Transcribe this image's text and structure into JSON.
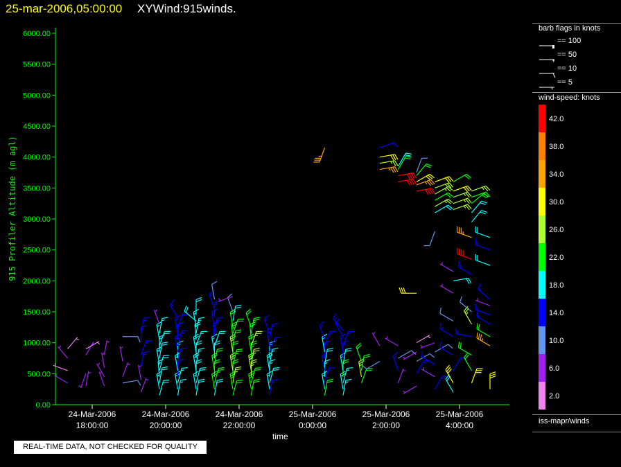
{
  "title": {
    "datetime": "25-mar-2006,05:00:00",
    "product": "XYWind:915winds."
  },
  "y_axis_label": "915 Profiler Altitude (m agl)",
  "x_axis_label": "time",
  "quality_notice": "REAL-TIME DATA, NOT CHECKED FOR QUALITY",
  "legend": {
    "barb_title": "barb flags in knots",
    "barb_keys": [
      {
        "label": "== 100",
        "value": 100
      },
      {
        "label": "== 50",
        "value": 50
      },
      {
        "label": "== 10",
        "value": 10
      },
      {
        "label": "== 5",
        "value": 5
      }
    ],
    "colorbar_title": "wind-speed: knots",
    "colorbar": [
      {
        "label": "42.0",
        "color": "#ff0000"
      },
      {
        "label": "38.0",
        "color": "#ff8000"
      },
      {
        "label": "34.0",
        "color": "#ffa500"
      },
      {
        "label": "30.0",
        "color": "#ffff00"
      },
      {
        "label": "26.0",
        "color": "#adff2f"
      },
      {
        "label": "22.0",
        "color": "#00ff00"
      },
      {
        "label": "18.0",
        "color": "#00ffff"
      },
      {
        "label": "14.0",
        "color": "#0000ff"
      },
      {
        "label": "10.0",
        "color": "#6495ed"
      },
      {
        "label": "6.0",
        "color": "#a020f0"
      },
      {
        "label": "2.0",
        "color": "#ee82ee"
      }
    ],
    "source": "iss-mapr/winds"
  },
  "chart_data": {
    "type": "wind-barb time-height",
    "title": "XYWind:915winds.",
    "xlabel": "time",
    "ylabel": "915 Profiler Altitude (m agl)",
    "xlim_hours": [
      17.0,
      29.35
    ],
    "ylim": [
      0,
      6200
    ],
    "y_ticks": [
      "0.00",
      "500.00",
      "1000.00",
      "1500.00",
      "2000.00",
      "2500.00",
      "3000.00",
      "3500.00",
      "4000.00",
      "4500.00",
      "5000.00",
      "5500.00",
      "6000.00"
    ],
    "x_ticks": [
      {
        "hour": 18,
        "date": "24-Mar-2006",
        "time": "18:00:00"
      },
      {
        "hour": 20,
        "date": "24-Mar-2006",
        "time": "20:00:00"
      },
      {
        "hour": 22,
        "date": "24-Mar-2006",
        "time": "22:00:00"
      },
      {
        "hour": 24,
        "date": "25-Mar-2006",
        "time": "0:00:00"
      },
      {
        "hour": 26,
        "date": "25-Mar-2006",
        "time": "2:00:00"
      },
      {
        "hour": 28,
        "date": "25-Mar-2006",
        "time": "4:00:00"
      }
    ],
    "speed_bins_knots": [
      0,
      4,
      8,
      12,
      16,
      20,
      24,
      28,
      32,
      36,
      40
    ],
    "profiles": [
      {
        "hour": 17.33,
        "obs": [
          [
            350,
            4,
            300
          ],
          [
            550,
            3,
            290
          ],
          [
            750,
            4,
            320
          ],
          [
            900,
            3,
            40
          ]
        ]
      },
      {
        "hour": 17.83,
        "obs": [
          [
            300,
            5,
            10
          ],
          [
            500,
            6,
            200
          ],
          [
            800,
            4,
            30
          ],
          [
            900,
            3,
            60
          ]
        ]
      },
      {
        "hour": 18.33,
        "obs": [
          [
            300,
            5,
            340
          ],
          [
            450,
            6,
            330
          ],
          [
            600,
            7,
            350
          ],
          [
            800,
            6,
            10
          ]
        ]
      },
      {
        "hour": 18.83,
        "obs": [
          [
            350,
            9,
            80
          ],
          [
            450,
            7,
            20
          ],
          [
            700,
            6,
            350
          ],
          [
            1100,
            10,
            90
          ]
        ]
      },
      {
        "hour": 19.33,
        "obs": [
          [
            200,
            7,
            20
          ],
          [
            400,
            7,
            350
          ],
          [
            600,
            14,
            10
          ],
          [
            800,
            13,
            20
          ],
          [
            1000,
            14,
            0
          ],
          [
            1150,
            14,
            10
          ]
        ]
      },
      {
        "hour": 19.83,
        "obs": [
          [
            150,
            18,
            15
          ],
          [
            250,
            17,
            350
          ],
          [
            350,
            18,
            10
          ],
          [
            450,
            17,
            355
          ],
          [
            550,
            18,
            15
          ],
          [
            650,
            17,
            350
          ],
          [
            750,
            18,
            10
          ],
          [
            850,
            17,
            0
          ],
          [
            950,
            18,
            20
          ],
          [
            1050,
            17,
            350
          ],
          [
            1150,
            16,
            10
          ],
          [
            1300,
            6,
            340
          ]
        ]
      },
      {
        "hour": 20.33,
        "obs": [
          [
            150,
            17,
            10
          ],
          [
            250,
            18,
            350
          ],
          [
            350,
            17,
            15
          ],
          [
            450,
            15,
            0
          ],
          [
            550,
            17,
            350
          ],
          [
            650,
            14,
            10
          ],
          [
            750,
            17,
            0
          ],
          [
            850,
            15,
            350
          ],
          [
            950,
            14,
            15
          ],
          [
            1050,
            15,
            0
          ],
          [
            1150,
            14,
            350
          ],
          [
            1250,
            14,
            20
          ],
          [
            1400,
            13,
            330
          ]
        ]
      },
      {
        "hour": 20.83,
        "obs": [
          [
            150,
            18,
            10
          ],
          [
            250,
            17,
            350
          ],
          [
            350,
            18,
            15
          ],
          [
            450,
            19,
            0
          ],
          [
            550,
            18,
            350
          ],
          [
            650,
            17,
            10
          ],
          [
            750,
            18,
            0
          ],
          [
            850,
            19,
            350
          ],
          [
            950,
            17,
            20
          ],
          [
            1050,
            18,
            355
          ],
          [
            1150,
            17,
            10
          ],
          [
            1250,
            16,
            350
          ],
          [
            1350,
            18,
            310
          ],
          [
            1450,
            18,
            0
          ]
        ]
      },
      {
        "hour": 21.33,
        "obs": [
          [
            150,
            18,
            10
          ],
          [
            250,
            22,
            350
          ],
          [
            350,
            23,
            15
          ],
          [
            450,
            22,
            0
          ],
          [
            550,
            21,
            350
          ],
          [
            650,
            22,
            10
          ],
          [
            750,
            18,
            0
          ],
          [
            850,
            17,
            350
          ],
          [
            950,
            18,
            20
          ],
          [
            1050,
            15,
            355
          ],
          [
            1150,
            14,
            10
          ],
          [
            1250,
            15,
            350
          ],
          [
            1400,
            14,
            0
          ],
          [
            1550,
            14,
            340
          ],
          [
            1700,
            10,
            350
          ]
        ]
      },
      {
        "hour": 21.83,
        "obs": [
          [
            150,
            22,
            15
          ],
          [
            250,
            23,
            350
          ],
          [
            350,
            25,
            10
          ],
          [
            450,
            22,
            0
          ],
          [
            550,
            26,
            350
          ],
          [
            650,
            23,
            15
          ],
          [
            750,
            22,
            0
          ],
          [
            850,
            25,
            350
          ],
          [
            950,
            22,
            10
          ],
          [
            1050,
            23,
            355
          ],
          [
            1150,
            22,
            20
          ],
          [
            1250,
            22,
            350
          ],
          [
            1350,
            18,
            10
          ],
          [
            1500,
            10,
            340
          ],
          [
            1750,
            6,
            250
          ]
        ]
      },
      {
        "hour": 22.33,
        "obs": [
          [
            150,
            22,
            10
          ],
          [
            250,
            23,
            350
          ],
          [
            350,
            22,
            15
          ],
          [
            450,
            25,
            0
          ],
          [
            550,
            27,
            350
          ],
          [
            650,
            26,
            10
          ],
          [
            750,
            23,
            0
          ],
          [
            850,
            22,
            350
          ],
          [
            950,
            25,
            20
          ],
          [
            1050,
            22,
            355
          ],
          [
            1150,
            23,
            10
          ],
          [
            1250,
            22,
            340
          ]
        ]
      },
      {
        "hour": 22.83,
        "obs": [
          [
            150,
            14,
            10
          ],
          [
            250,
            17,
            350
          ],
          [
            350,
            18,
            15
          ],
          [
            450,
            17,
            0
          ],
          [
            550,
            18,
            350
          ],
          [
            650,
            17,
            10
          ],
          [
            750,
            16,
            0
          ],
          [
            850,
            14,
            20
          ],
          [
            950,
            15,
            350
          ],
          [
            1050,
            14,
            10
          ],
          [
            1150,
            14,
            340
          ]
        ]
      },
      {
        "hour": 24.33,
        "obs": [
          [
            150,
            22,
            10
          ],
          [
            250,
            17,
            350
          ],
          [
            350,
            15,
            15
          ],
          [
            450,
            17,
            0
          ],
          [
            550,
            14,
            350
          ],
          [
            650,
            18,
            10
          ],
          [
            750,
            15,
            0
          ],
          [
            850,
            17,
            350
          ],
          [
            950,
            14,
            20
          ],
          [
            1050,
            15,
            340
          ],
          [
            4150,
            34,
            200
          ]
        ]
      },
      {
        "hour": 24.83,
        "obs": [
          [
            150,
            17,
            10
          ],
          [
            250,
            18,
            350
          ],
          [
            350,
            17,
            15
          ],
          [
            450,
            22,
            0
          ],
          [
            550,
            17,
            350
          ],
          [
            650,
            18,
            10
          ],
          [
            750,
            15,
            0
          ],
          [
            850,
            14,
            350
          ],
          [
            950,
            14,
            20
          ],
          [
            1100,
            14,
            330
          ],
          [
            1200,
            14,
            320
          ]
        ]
      },
      {
        "hour": 25.33,
        "obs": [
          [
            350,
            22,
            20
          ],
          [
            450,
            25,
            350
          ],
          [
            550,
            22,
            10
          ],
          [
            700,
            22,
            340
          ]
        ]
      },
      {
        "hour": 25.83,
        "obs": [
          [
            700,
            10,
            240
          ],
          [
            950,
            6,
            330
          ],
          [
            3800,
            34,
            80
          ],
          [
            3900,
            26,
            80
          ],
          [
            4000,
            29,
            80
          ],
          [
            4150,
            14,
            70
          ]
        ]
      },
      {
        "hour": 26.33,
        "obs": [
          [
            350,
            6,
            20
          ],
          [
            550,
            14,
            340
          ],
          [
            750,
            10,
            60
          ],
          [
            950,
            6,
            300
          ],
          [
            3600,
            42,
            80
          ],
          [
            3700,
            41,
            80
          ],
          [
            3800,
            22,
            30
          ],
          [
            3850,
            18,
            30
          ]
        ]
      },
      {
        "hour": 26.83,
        "obs": [
          [
            300,
            6,
            240
          ],
          [
            500,
            14,
            30
          ],
          [
            700,
            9,
            60
          ],
          [
            850,
            6,
            240
          ],
          [
            1000,
            3,
            60
          ],
          [
            1800,
            29,
            270
          ],
          [
            3450,
            42,
            80
          ],
          [
            3550,
            34,
            70
          ],
          [
            3600,
            30,
            60
          ],
          [
            3700,
            22,
            40
          ],
          [
            3750,
            10,
            20
          ]
        ]
      },
      {
        "hour": 27.33,
        "obs": [
          [
            250,
            14,
            30
          ],
          [
            450,
            6,
            300
          ],
          [
            650,
            14,
            300
          ],
          [
            850,
            10,
            60
          ],
          [
            1000,
            6,
            250
          ],
          [
            2800,
            10,
            200
          ],
          [
            3100,
            18,
            60
          ],
          [
            3200,
            26,
            60
          ],
          [
            3300,
            22,
            60
          ],
          [
            3400,
            26,
            60
          ],
          [
            3500,
            26,
            70
          ],
          [
            3600,
            29,
            70
          ]
        ]
      },
      {
        "hour": 27.83,
        "obs": [
          [
            200,
            18,
            330
          ],
          [
            350,
            30,
            330
          ],
          [
            550,
            14,
            30
          ],
          [
            800,
            14,
            300
          ],
          [
            1100,
            14,
            300
          ],
          [
            1350,
            10,
            300
          ],
          [
            1800,
            6,
            300
          ],
          [
            2000,
            18,
            80
          ],
          [
            2150,
            6,
            300
          ],
          [
            3150,
            26,
            70
          ],
          [
            3250,
            26,
            70
          ],
          [
            3350,
            26,
            70
          ],
          [
            3450,
            29,
            70
          ],
          [
            3600,
            22,
            60
          ]
        ]
      },
      {
        "hour": 28.33,
        "obs": [
          [
            350,
            30,
            20
          ],
          [
            550,
            22,
            330
          ],
          [
            800,
            22,
            300
          ],
          [
            1100,
            14,
            280
          ],
          [
            1300,
            26,
            330
          ],
          [
            1500,
            10,
            310
          ],
          [
            2100,
            14,
            300
          ],
          [
            2350,
            42,
            290
          ],
          [
            2700,
            34,
            290
          ],
          [
            2950,
            18,
            40
          ],
          [
            3100,
            18,
            40
          ],
          [
            3250,
            22,
            50
          ],
          [
            3350,
            22,
            70
          ],
          [
            3450,
            26,
            70
          ]
        ]
      },
      {
        "hour": 28.83,
        "obs": [
          [
            250,
            30,
            0
          ],
          [
            950,
            34,
            300
          ],
          [
            1100,
            22,
            300
          ],
          [
            1300,
            14,
            300
          ],
          [
            1450,
            14,
            290
          ],
          [
            1600,
            6,
            290
          ],
          [
            1700,
            14,
            310
          ],
          [
            2250,
            18,
            290
          ],
          [
            2500,
            14,
            290
          ],
          [
            2700,
            18,
            290
          ]
        ]
      }
    ]
  }
}
